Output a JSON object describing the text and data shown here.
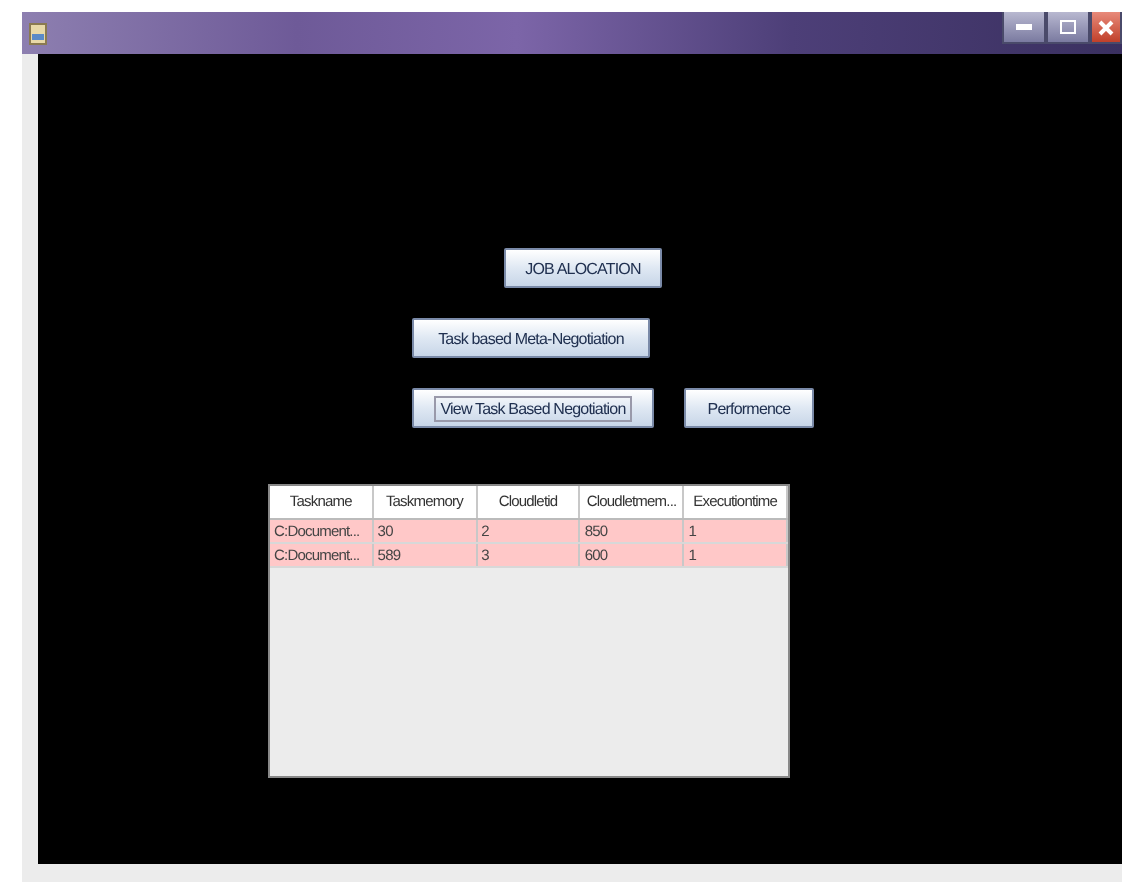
{
  "buttons": [
    {
      "label": "JOB ALOCATION",
      "focused": false
    },
    {
      "label": "Task based Meta-Negotiation",
      "focused": false
    },
    {
      "label": "View Task Based Negotiation",
      "focused": true
    },
    {
      "label": "Performence",
      "focused": false
    }
  ],
  "table": {
    "columns": [
      "Taskname",
      "Taskmemory",
      "Cloudletid",
      "Cloudletmem...",
      "Executiontime"
    ],
    "rows": [
      {
        "cells": [
          "C:Document...",
          "30",
          "2",
          "850",
          "1"
        ],
        "selected": true
      },
      {
        "cells": [
          "C:Document...",
          "589",
          "3",
          "600",
          "1"
        ],
        "selected": true
      }
    ]
  }
}
